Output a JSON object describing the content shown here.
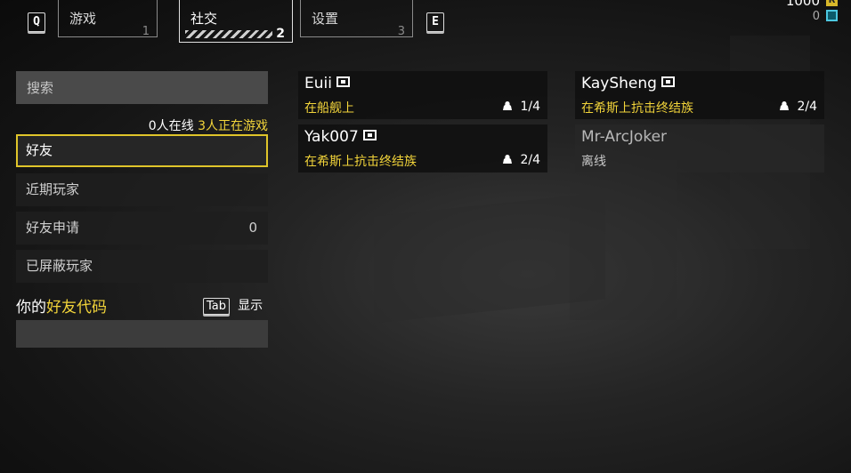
{
  "tabs": {
    "prev_key": "Q",
    "next_key": "E",
    "items": [
      {
        "label": "游戏",
        "number": "1"
      },
      {
        "label": "社交",
        "number": "2"
      },
      {
        "label": "设置",
        "number": "3"
      }
    ]
  },
  "currency": {
    "primary_value": "1000",
    "primary_icon": "R",
    "secondary_value": "0",
    "secondary_icon": "coin-icon"
  },
  "sidebar": {
    "search_placeholder": "搜索",
    "online_text": "0人在线",
    "ingame_text": "3人正在游戏",
    "items": [
      {
        "label": "好友"
      },
      {
        "label": "近期玩家"
      },
      {
        "label": "好友申请",
        "count": "0"
      },
      {
        "label": "已屏蔽玩家"
      }
    ],
    "friend_code": {
      "prefix": "你的",
      "highlight": "好友代码",
      "key": "Tab",
      "action": "显示",
      "value": ""
    }
  },
  "friends": [
    {
      "name": "Euii",
      "status": "在船舰上",
      "party": "1/4",
      "platform": "pc-icon"
    },
    {
      "name": "KaySheng",
      "status": "在希斯上抗击终结族",
      "party": "2/4",
      "platform": "pc-icon"
    },
    {
      "name": "Yak007",
      "status": "在希斯上抗击终结族",
      "party": "2/4",
      "platform": "pc-icon"
    },
    {
      "name": "Mr-ArcJoker",
      "status": "离线",
      "party": "",
      "platform": ""
    }
  ],
  "colors": {
    "accent": "#f2d43a",
    "selected_border": "#e0c52a"
  }
}
